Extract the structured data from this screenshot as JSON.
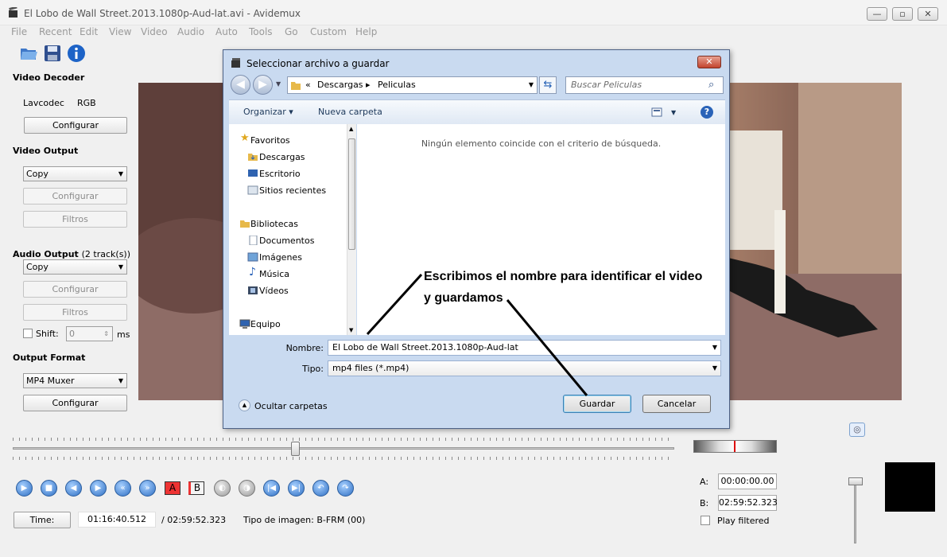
{
  "window": {
    "title": "El Lobo de Wall Street.2013.1080p-Aud-lat.avi - Avidemux",
    "controls": [
      "—",
      "▫",
      "✕"
    ]
  },
  "menu": [
    "File",
    "Recent",
    "Edit",
    "View",
    "Video",
    "Audio",
    "Auto",
    "Tools",
    "Go",
    "Custom",
    "Help"
  ],
  "sidebar": {
    "video_decoder": {
      "title": "Video Decoder",
      "decoder": "Lavcodec",
      "format": "RGB",
      "configure": "Configurar"
    },
    "video_output": {
      "title": "Video Output",
      "selected": "Copy",
      "configure": "Configurar",
      "filters": "Filtros"
    },
    "audio_output": {
      "title": "Audio Output",
      "tracks": "(2 track(s))",
      "selected": "Copy",
      "configure": "Configurar",
      "filters": "Filtros",
      "shift_label": "Shift:",
      "shift_value": "0",
      "shift_unit": "ms"
    },
    "output_format": {
      "title": "Output Format",
      "selected": "MP4 Muxer",
      "configure": "Configurar"
    }
  },
  "dialog": {
    "title": "Seleccionar archivo a guardar",
    "close": "✕",
    "address": {
      "prefix": "«",
      "crumb1": "Descargas",
      "separator": "▸",
      "crumb2": "Peliculas"
    },
    "search_placeholder": "Buscar Peliculas",
    "organize": "Organizar ▾",
    "new_folder": "Nueva carpeta",
    "nav": {
      "favorites": "Favoritos",
      "downloads": "Descargas",
      "desktop": "Escritorio",
      "recent": "Sitios recientes",
      "libraries": "Bibliotecas",
      "documents": "Documentos",
      "images": "Imágenes",
      "music": "Música",
      "videos": "Vídeos",
      "computer": "Equipo"
    },
    "empty_message": "Ningún elemento coincide con el criterio de búsqueda.",
    "name_label": "Nombre:",
    "name_value": "El Lobo de Wall Street.2013.1080p-Aud-lat",
    "type_label": "Tipo:",
    "type_value": "mp4 files (*.mp4)",
    "hide_folders": "Ocultar carpetas",
    "save": "Guardar",
    "cancel": "Cancelar"
  },
  "annotation": {
    "line1": "Escribimos el nombre para identificar el  video",
    "line2": "y guardamos"
  },
  "playback": {
    "time_button": "Time:",
    "current_time": "01:16:40.512",
    "total_time": "/ 02:59:52.323",
    "frame_type": "Tipo de imagen:  B-FRM (00)",
    "marker_a_label": "A:",
    "marker_a": "00:00:00.00",
    "marker_b_label": "B:",
    "marker_b": "02:59:52.323",
    "play_filtered": "Play filtered",
    "a_button": "A",
    "b_button": "B",
    "position": 0.427
  }
}
